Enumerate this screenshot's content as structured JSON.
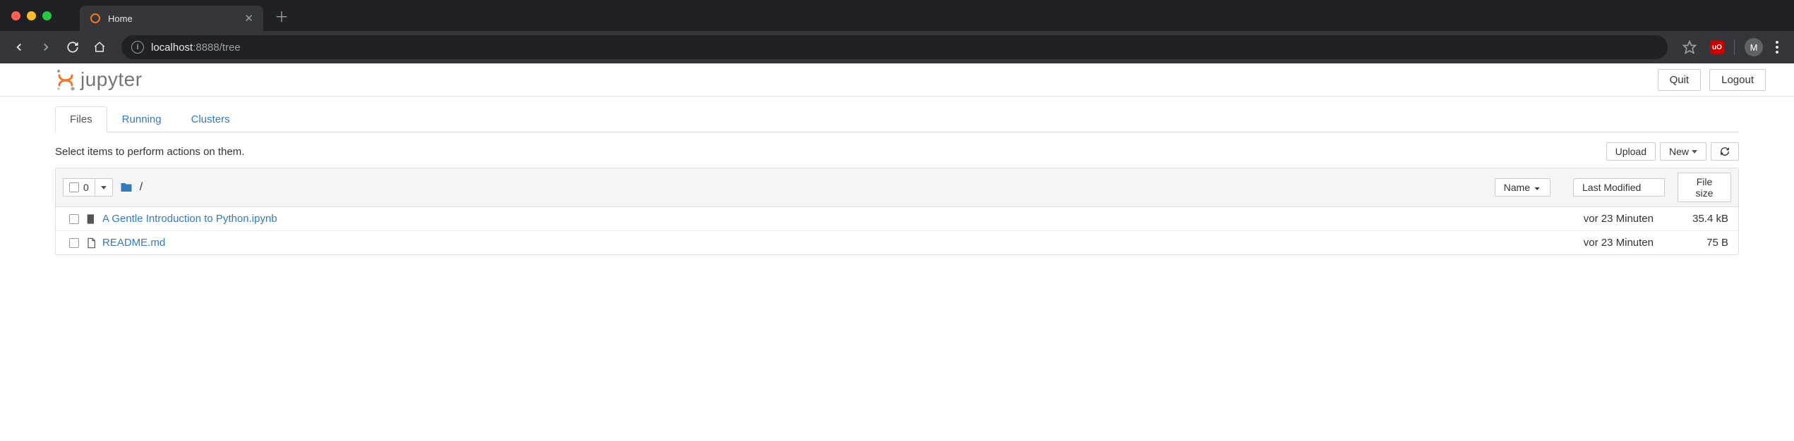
{
  "browser": {
    "tab_title": "Home",
    "url_host": "localhost",
    "url_port": ":8888",
    "url_path": "/tree",
    "avatar_letter": "M",
    "ext_label": "uO"
  },
  "header": {
    "logo_text": "jupyter",
    "quit_label": "Quit",
    "logout_label": "Logout"
  },
  "tabs": {
    "files": "Files",
    "running": "Running",
    "clusters": "Clusters"
  },
  "actions": {
    "hint": "Select items to perform actions on them.",
    "upload": "Upload",
    "new": "New"
  },
  "list_header": {
    "selected_count": "0",
    "breadcrumb": "/",
    "name": "Name",
    "last_modified": "Last Modified",
    "file_size": "File size"
  },
  "files": [
    {
      "icon": "notebook",
      "name": "A Gentle Introduction to Python.ipynb",
      "modified": "vor 23 Minuten",
      "size": "35.4 kB"
    },
    {
      "icon": "file",
      "name": "README.md",
      "modified": "vor 23 Minuten",
      "size": "75 B"
    }
  ],
  "colors": {
    "link": "#337ab7",
    "jupyter_orange": "#f37726"
  }
}
